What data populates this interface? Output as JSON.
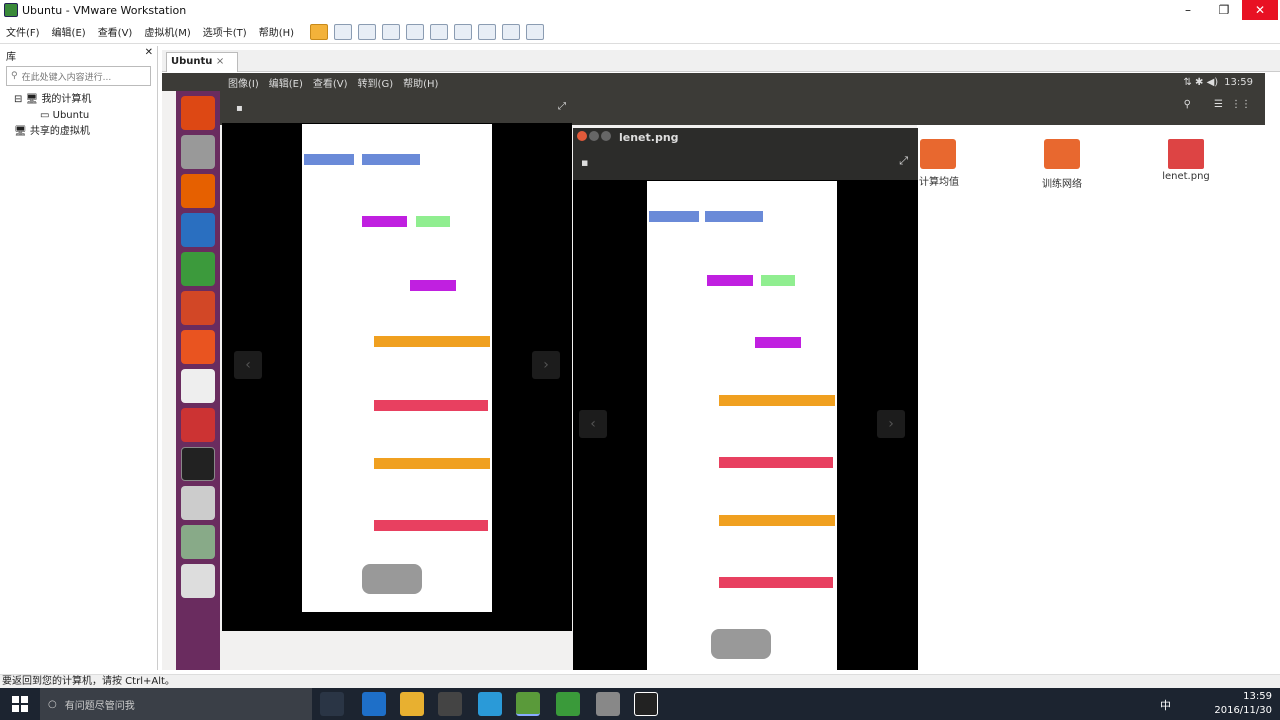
{
  "window": {
    "title": "Ubuntu - VMware Workstation"
  },
  "menu": [
    "文件(F)",
    "编辑(E)",
    "查看(V)",
    "虚拟机(M)",
    "选项卡(T)",
    "帮助(H)"
  ],
  "library": {
    "header": "库",
    "search_placeholder": "在此处键入内容进行...",
    "my_computer": "我的计算机",
    "vm_name": "Ubuntu",
    "shared": "共享的虚拟机"
  },
  "tab": {
    "label": "Ubuntu"
  },
  "ubuntu_menu": [
    "图像(I)",
    "编辑(E)",
    "查看(V)",
    "转到(G)",
    "帮助(H)"
  ],
  "ubuntu_time": "13:59",
  "viewer": {
    "title": "lenet.png"
  },
  "files": [
    {
      "name": "计算均值"
    },
    {
      "name": "训练网络"
    },
    {
      "name": "lenet.png"
    }
  ],
  "status_text": "要返回到您的计算机，请按 Ctrl+Alt。",
  "taskbar": {
    "search": "有问题尽管问我",
    "time": "13:59",
    "date": "2016/11/30",
    "ime": "中"
  },
  "colors": {
    "launcher": "#6a2c5f",
    "blue": "#6a8ad8",
    "purple": "#c020e0",
    "green": "#90ee90",
    "orange": "#f0a020",
    "red": "#e84060"
  }
}
